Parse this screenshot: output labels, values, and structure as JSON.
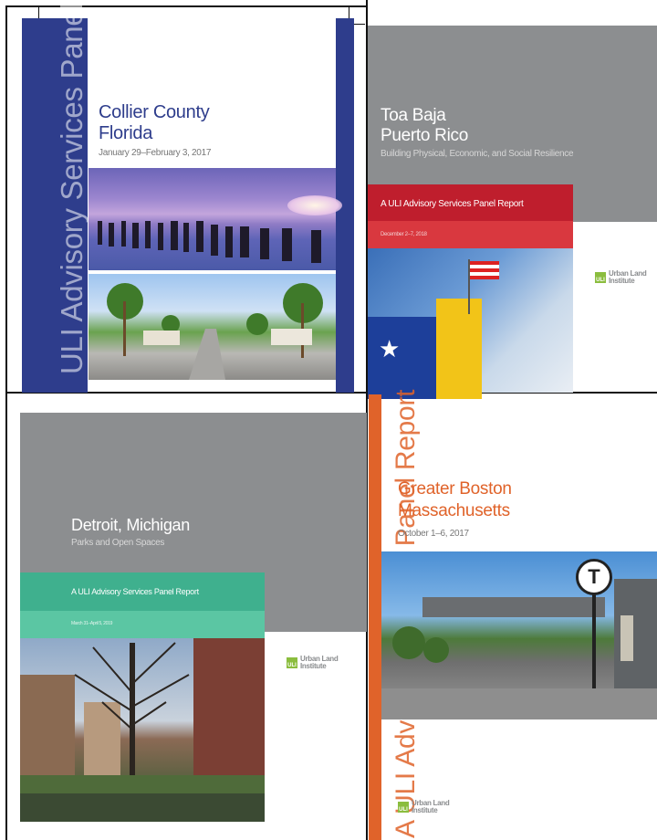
{
  "covers": {
    "collier": {
      "vertical_label": "ULI Advisory Services Panel Report",
      "title_line1": "Collier County",
      "title_line2": "Florida",
      "date": "January 29–February 3, 2017"
    },
    "toa_baja": {
      "title_line1": "Toa Baja",
      "title_line2": "Puerto Rico",
      "subtitle": "Building Physical, Economic, and Social Resilience",
      "band_label": "A ULI Advisory Services Panel Report",
      "date": "December 2–7, 2018",
      "logo_line1": "Urban Land",
      "logo_line2": "Institute"
    },
    "detroit": {
      "title": "Detroit, Michigan",
      "subtitle": "Parks and Open Spaces",
      "band_label": "A ULI Advisory Services Panel Report",
      "date": "March 31–April 5, 2019",
      "logo_line1": "Urban Land",
      "logo_line2": "Institute"
    },
    "boston": {
      "vertical_label": "A ULI Advisory Services Panel Report",
      "title_line1": "Greater Boston",
      "title_line2": "Massachusetts",
      "date": "October 1–6, 2017",
      "logo_line1": "Urban Land",
      "logo_line2": "Institute"
    }
  },
  "logo_mark": "ULI",
  "transit_sign": "T"
}
